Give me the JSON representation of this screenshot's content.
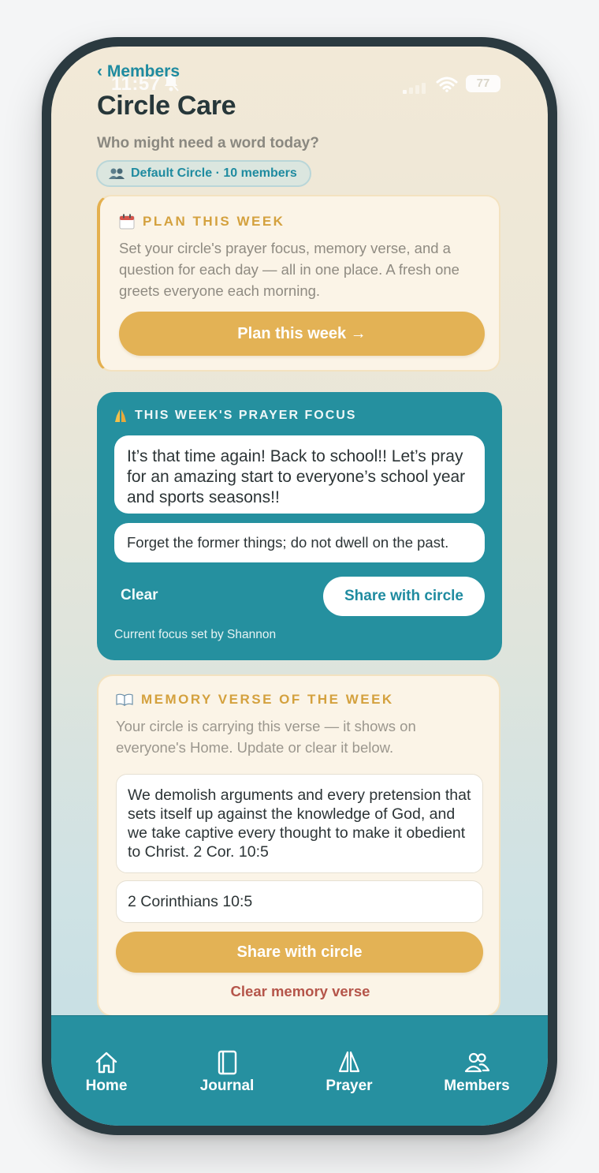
{
  "status_bar": {
    "time": "11:57",
    "battery": "77"
  },
  "nav": {
    "back_label": "Members"
  },
  "header": {
    "title": "Circle Care",
    "subtitle": "Who might need a word today?",
    "circle_pill": "Default Circle · 10 members"
  },
  "plan_card": {
    "eyebrow": "PLAN THIS WEEK",
    "description": "Set your circle's prayer focus, memory verse, and a question for each day — all in one place. A fresh one greets everyone each morning.",
    "button_label": "Plan this week →"
  },
  "prayer_focus": {
    "eyebrow": "THIS WEEK'S PRAYER FOCUS",
    "focus_text": "It’s that time again! Back to school!! Let’s pray for an amazing start to everyone’s school year and sports seasons!!",
    "verse_preview": "Forget the former things; do not dwell on the past.",
    "clear_label": "Clear",
    "share_label": "Share with circle",
    "set_by": "Current focus set by Shannon"
  },
  "memory_verse": {
    "eyebrow": "MEMORY VERSE OF THE WEEK",
    "description": "Your circle is carrying this verse — it shows on everyone's Home. Update or clear it below.",
    "verse_text": "We demolish arguments and every pretension that sets itself up against the knowledge of God, and we take captive every thought to make it obedient to Christ. 2 Cor. 10:5",
    "reference": "2 Corinthians 10:5",
    "share_label": "Share with circle",
    "clear_label": "Clear memory verse"
  },
  "tabbar": {
    "tabs": [
      {
        "label": "Home",
        "icon": "home-icon"
      },
      {
        "label": "Journal",
        "icon": "journal-icon"
      },
      {
        "label": "Prayer",
        "icon": "praying-hands-icon"
      },
      {
        "label": "Members",
        "icon": "members-icon"
      }
    ]
  },
  "colors": {
    "teal": "#2690a0",
    "gold": "#e3b255",
    "cream": "#fbf4e7",
    "danger": "#b5554a"
  }
}
